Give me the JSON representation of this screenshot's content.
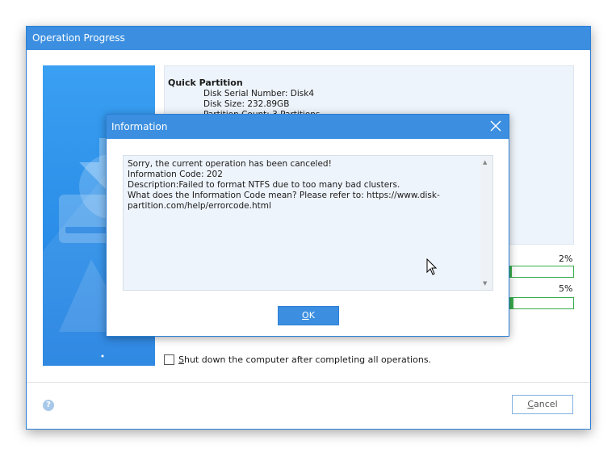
{
  "window": {
    "title": "Operation Progress"
  },
  "info": {
    "title": "Quick Partition",
    "disk_serial": "Disk Serial Number: Disk4",
    "disk_size": "Disk Size: 232.89GB",
    "partition_count": "Partition Count:          3 Partitions"
  },
  "progress": [
    {
      "percent_label": "2%",
      "value": 0.02
    },
    {
      "percent_label": "5%",
      "value": 0.05
    }
  ],
  "options": {
    "shutdown_label": "Shut down the computer after completing all operations.",
    "shutdown_accel": "S",
    "shutdown_rest": "hut down the computer after completing all operations.",
    "shutdown_checked": false
  },
  "footer": {
    "help_icon": "question-circle-icon",
    "cancel_accel": "C",
    "cancel_rest": "ancel",
    "cancel_label": "Cancel"
  },
  "dialog": {
    "title": "Information",
    "close_icon": "close-icon",
    "lines": [
      "Sorry, the current operation has been canceled!",
      "Information Code: 202",
      "Description:Failed to format NTFS due to too many bad clusters.",
      "",
      "What does the Information Code mean? Please refer to: https://www.disk-",
      "partition.com/help/errorcode.html"
    ],
    "ok_accel": "O",
    "ok_rest": "K",
    "ok_label": "OK"
  },
  "colors": {
    "accent": "#3c8fe0",
    "progress": "#3aae4e",
    "panel_bg": "#eef4fb"
  }
}
